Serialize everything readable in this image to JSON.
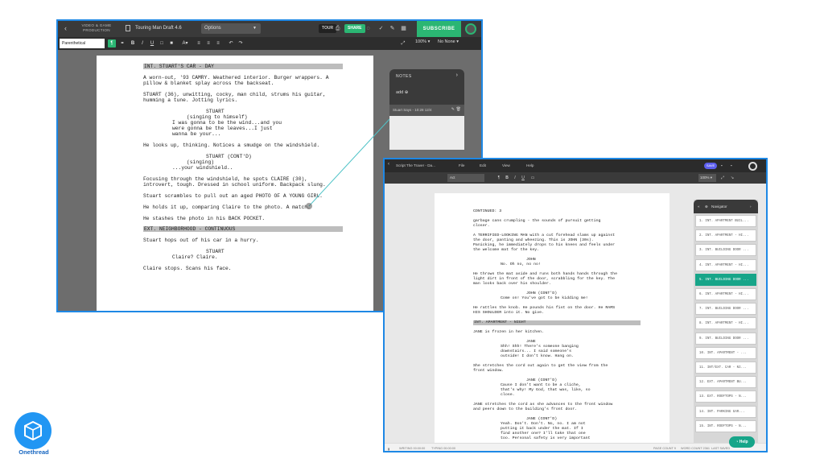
{
  "frame1": {
    "brand": "VIDEO & GAME PRODUCTION",
    "doc_title": "Touring Man Draft 4.6",
    "options_label": "Options",
    "tour_label": "TOUR",
    "share_label": "SHARE",
    "subscribe_label": "SUBSCRIBE",
    "element_select": "Parenthetical",
    "format_buttons": [
      "B",
      "I",
      "U"
    ],
    "size_label": "A▾",
    "zoom_label": "100% ▾",
    "revision_label": "No None ▾",
    "notes": {
      "title": "NOTES",
      "add_label": "add",
      "item_label": "Stuart Says - 10:28 12/4"
    },
    "script": {
      "slug1": "INT. STUART'S CAR - DAY",
      "action1a": "A worn-out, '93 CAMRY. Weathered interior. Burger wrappers. A",
      "action1b": "pillow & blanket splay across the backseat.",
      "action2a": "STUART (36), unwitting, cocky, man child, strums his guitar,",
      "action2b": "humming a tune. Jotting lyrics.",
      "char1": "STUART",
      "paren1": "(singing to himself)",
      "dial1a": "I was gonna to be the wind...and you",
      "dial1b": "were gonna be the leaves...I just",
      "dial1c": "wanna be your...",
      "action3": "He looks up, thinking. Notices a smudge on the windshield.",
      "char2": "STUART (CONT'D)",
      "paren2": "(singing)",
      "dial2": "...your windshield..",
      "action4a": "Focusing through the windshield, he spots CLAIRE (30),",
      "action4b": "introvert, tough. Dressed in school uniform. Backpack slung.",
      "action5": "Stuart scrambles to pull out an aged PHOTO OF A YOUNG GIRL.",
      "action6": "He holds it up, comparing Claire to the photo. A match.",
      "action7": "He stashes the photo in his BACK POCKET.",
      "slug2": "EXT. NEIGHBORHOOD - CONTINUOUS",
      "action8": "Stuart hops out of his car in a hurry.",
      "char3": "STUART",
      "dial3": "Claire? Claire.",
      "action9": "Claire stops. Scans his face."
    }
  },
  "frame2": {
    "doc_title": "Script The Traver - Da...",
    "menu": [
      "File",
      "Edit",
      "View",
      "Help"
    ],
    "save_label": "SAVE",
    "element_select": "Act",
    "zoom_label": "100% ▾",
    "page_left": "4",
    "page_right": "6",
    "script": {
      "l1": "CONTINUED: 3",
      "l2": "garbage cans crumpling - the sounds of pursuit getting",
      "l3": "closer.",
      "l4": "A TERRIFIED-LOOKING MAN with a cut forehead slams up against",
      "l5": "the door, panting and wheezing. This is JOHN (30s).",
      "l6": "Panicking, he immediately drops to his knees and feels under",
      "l7": "the welcome mat for the key.",
      "c1": "JOHN",
      "d1": "No. Oh no, no no!",
      "l8": "He throws the mat aside and runs both hands hands through the",
      "l9": "light dirt in front of the door, scrabbling for the key. The",
      "l10": "man looks back over his shoulder.",
      "c2": "JOHN (CONT'D)",
      "d2": "Come on! You've got to be kidding me!",
      "l11": "He rattles the knob. He pounds his fist on the door. He RAMS",
      "l12": "HIS SHOULDER into it. No give.",
      "slug": "INT. APARTMENT - NIGHT",
      "l13": "JANE is frozen in her kitchen.",
      "c3": "JANE",
      "d3a": "Shh! Shh! There's someone banging",
      "d3b": "downstairs... I said someone's",
      "d3c": "outside! I don't know. Hang on.",
      "l14": "She stretches the cord out again to get the view from the",
      "l15": "front window.",
      "c4": "JANE (CONT'D)",
      "d4a": "Cause I don't want to be a cliche,",
      "d4b": "that's why! My God, that was, like, so",
      "d4c": "close.",
      "l16": "JANE stretches the cord as she advances to the front window",
      "l17": "and peers down to the building's front door.",
      "c5": "JANE (CONT'D)",
      "d5a": "Yeah. Don't. Don't. No, no. I am not",
      "d5b": "putting it back under the mat. If I",
      "d5c": "find another one? I'll take that one",
      "d5d": "too. Personal safety is very important"
    },
    "navigator": {
      "title": "Navigator",
      "items": [
        "1. INT. APARTMENT BUIL...",
        "2. INT. APARTMENT - HI...",
        "3. INT. BUILDING DOOR ...",
        "4. INT. APARTMENT - HI...",
        "5. INT. BUILDING DOOR ...",
        "6. INT. APARTMENT - HI...",
        "7. INT. BUILDING DOOR ...",
        "8. INT. APARTMENT - HI...",
        "9. INT. BUILDING DOOR ...",
        "10. INT. APARTMENT - ...",
        "11. INT/EXT. CAR - NI...",
        "12. EXT. APARTMENT BU...",
        "13. EXT. ROOFTOPS - N...",
        "14. INT. PARKING GAR...",
        "15. INT. ROOFTOPS - N..."
      ],
      "active_index": 4
    },
    "status": {
      "left1": "WRITING 00:00:00",
      "left2": "TYPING 00:00:00",
      "page_count": "PAGE COUNT 9",
      "word_count": "WORD COUNT 2361",
      "last_saved": "LAST SAVED"
    },
    "help_label": "Help"
  },
  "logo": {
    "name": "Onethread"
  },
  "colors": {
    "frame_border": "#1e88e5",
    "accent_green": "#2bb673",
    "nav_active": "#17a589",
    "connector": "#4fc3c7"
  }
}
